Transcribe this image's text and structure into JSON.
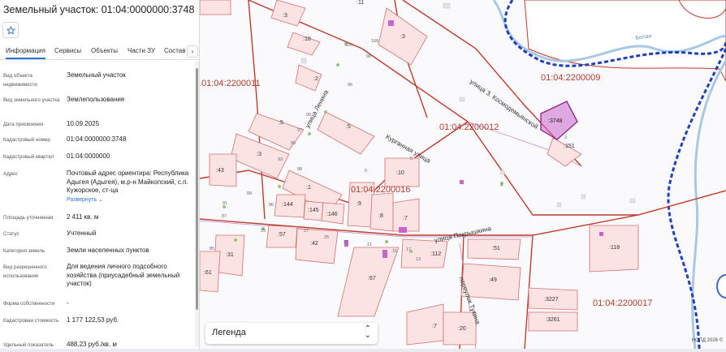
{
  "panel": {
    "title": "Земельный участок: 01:04:0000000:3748",
    "star_icon": "star-icon",
    "tabs": [
      "Информация",
      "Сервисы",
      "Объекты",
      "Части ЗУ",
      "Состав"
    ],
    "next_icon": "chevron-right-icon",
    "props": [
      {
        "label": "Вид объекта недвижимости",
        "value": "Земельный участок"
      },
      {
        "label": "Вид земельного участка",
        "value": "Землепользование"
      },
      {
        "label": "Дата присвоения",
        "value": "10.09.2025"
      },
      {
        "label": "Кадастровый номер",
        "value": "01:04:0000000:3748"
      },
      {
        "label": "Кадастровый квартал",
        "value": "01:04:0000000"
      },
      {
        "label": "Адрес",
        "value": "Почтовый адрес ориентира: Республика Адыгея (Адыгея), м.р-н Майкопский, с.п. Кужорское, ст-ца",
        "link": "Развернуть"
      },
      {
        "label": "Площадь уточненная",
        "value": "2 411 кв. м"
      },
      {
        "label": "Статус",
        "value": "Учтенный"
      },
      {
        "label": "Категория земель",
        "value": "Земли населенных пунктов"
      },
      {
        "label": "Вид разрешенного использования",
        "value": "Для ведения личного подсобного хозяйства (приусадебный земельный участок)"
      },
      {
        "label": "Форма собственности",
        "value": "-"
      },
      {
        "label": "Кадастровая стоимость",
        "value": "1 177 122,53 руб."
      },
      {
        "label": "Удельный показатель",
        "value": "488,23 руб./кв. м"
      }
    ]
  },
  "map": {
    "quarters": [
      "01:04:2200011",
      "01:04:2200009",
      "01:04:2200012",
      "01:04:2200016",
      "01:04:2200017"
    ],
    "streets": [
      "улица Ленина",
      "улица З. Космодемьянской",
      "Курганная улица",
      "улица Покрышкина",
      "переулок Тукина"
    ],
    "parcels": [
      ":11",
      ":3",
      ":18",
      ":3",
      ":2",
      ":5",
      ":5",
      ":3",
      ":43",
      ":1",
      ":10",
      ":144",
      ":145",
      ":146",
      ":9",
      ":8",
      ":7",
      ":57",
      ":42",
      ":31",
      ":61",
      ":67",
      ":112",
      ":51",
      ":49",
      ":3227",
      ":3261",
      ":118",
      ":151",
      ":3748",
      ":7",
      ":20"
    ],
    "house_numbers": [
      "105",
      "98",
      "96",
      "99",
      "97",
      "95",
      "93",
      "89",
      "88",
      "91",
      "87",
      "85",
      "86",
      "29",
      "27",
      "25",
      "23",
      "21",
      "15",
      "17",
      "13",
      "168",
      "5",
      "5",
      "4",
      "2"
    ],
    "river_label": "Белая",
    "legend_label": "Легенда",
    "legend_icon": "chevron-up-down-icon",
    "copyright": "НСПД 2026 ©",
    "colors": {
      "boundary": "#c0392b",
      "parcel_fill": "#fbe3e3",
      "selected_fill": "#c964c9",
      "river": "#1f3fbf",
      "water": "#a8c8e6"
    }
  }
}
